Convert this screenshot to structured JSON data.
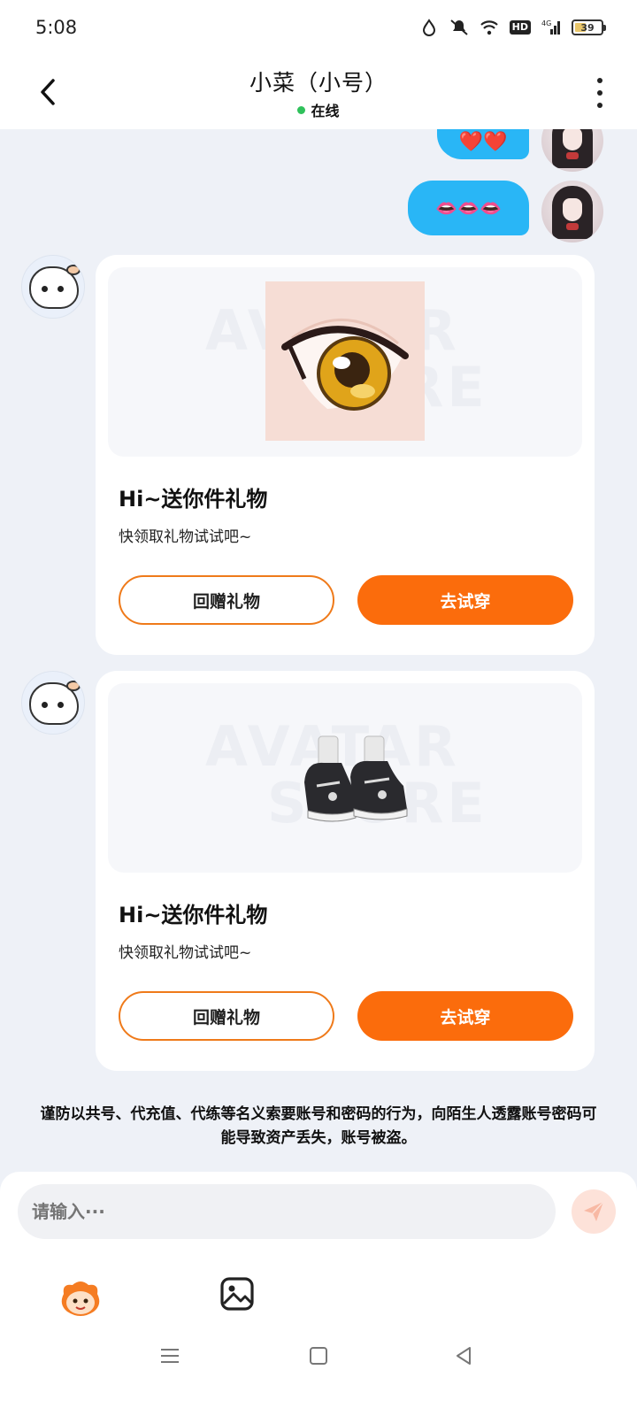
{
  "status_bar": {
    "time": "5:08",
    "hd": "HD",
    "network": "4G",
    "battery": "39"
  },
  "header": {
    "title": "小菜（小号）",
    "status": "在线",
    "status_color": "#2fc15b"
  },
  "messages": {
    "out1": {
      "emoji": "❤️❤️"
    },
    "out2": {
      "emoji": "👄👄👄"
    }
  },
  "gift_cards": [
    {
      "title": "Hi~送你件礼物",
      "subtitle": "快领取礼物试试吧~",
      "watermark_line1": "AVATAR",
      "watermark_line2": "STORE",
      "return_label": "回赠礼物",
      "try_label": "去试穿",
      "item": "eye"
    },
    {
      "title": "Hi~送你件礼物",
      "subtitle": "快领取礼物试试吧~",
      "watermark_line1": "AVATAR",
      "watermark_line2": "STORE",
      "return_label": "回赠礼物",
      "try_label": "去试穿",
      "item": "sneakers"
    }
  ],
  "notice": "谨防以共号、代充值、代练等名义索要账号和密码的行为，向陌生人透露账号密码可能导致资产丢失，账号被盗。",
  "input": {
    "placeholder": "请输入···"
  },
  "colors": {
    "accent": "#fb6c0c",
    "bubble": "#29b6f6"
  }
}
